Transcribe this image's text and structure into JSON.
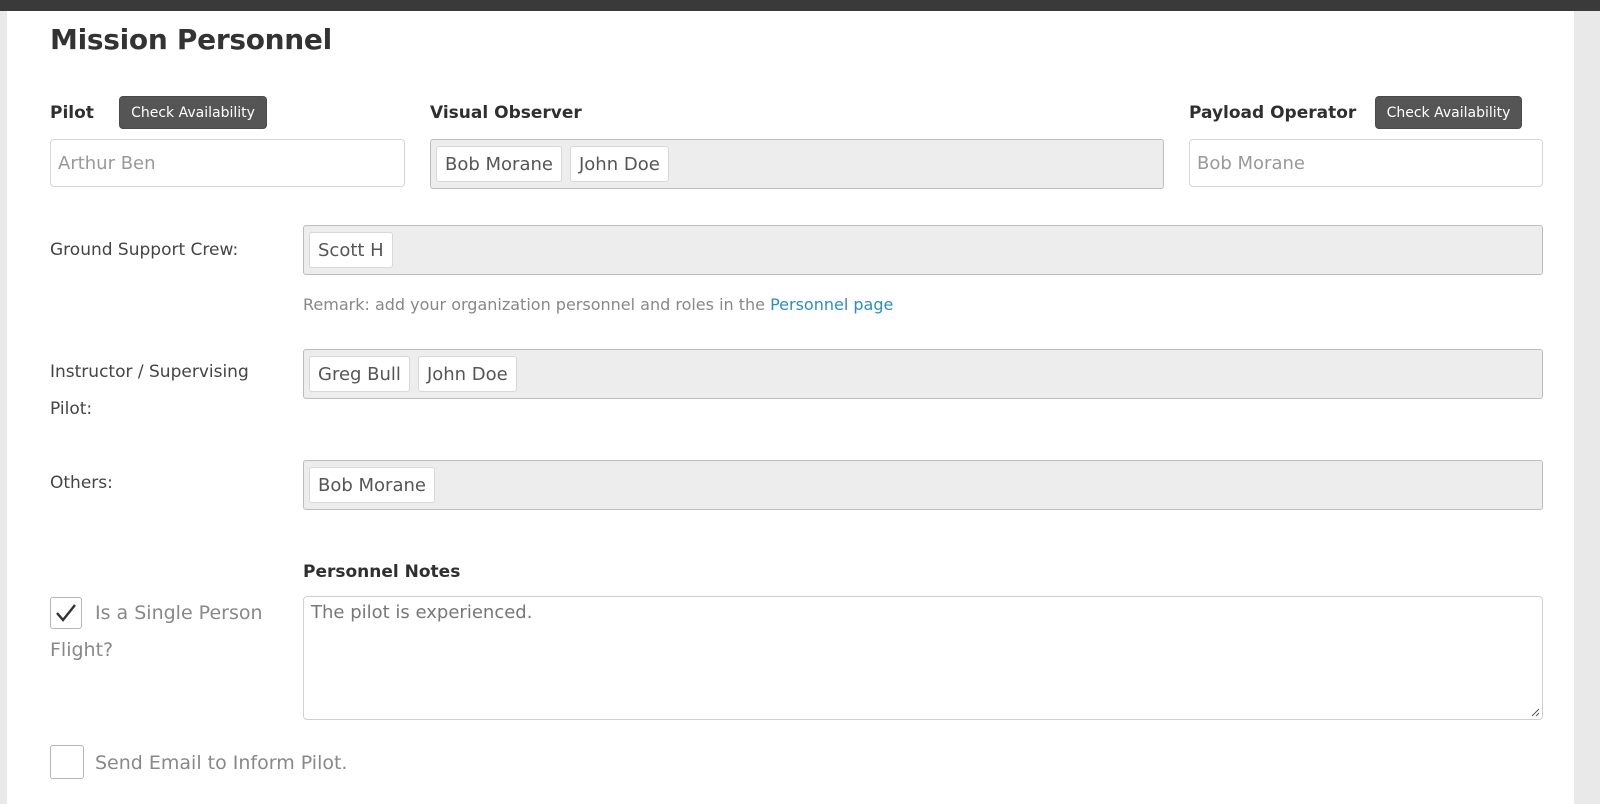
{
  "section_title": "Mission Personnel",
  "pilot": {
    "label": "Pilot",
    "check_button": "Check Availability",
    "value": "Arthur Ben"
  },
  "visual_observer": {
    "label": "Visual Observer",
    "tags": [
      "Bob Morane",
      "John Doe"
    ]
  },
  "payload_operator": {
    "label": "Payload Operator",
    "check_button": "Check Availability",
    "value": "Bob Morane"
  },
  "ground_support": {
    "label": "Ground Support Crew:",
    "tags": [
      "Scott H"
    ]
  },
  "remark": {
    "text": "Remark: add your organization personnel and roles in the ",
    "link": "Personnel page"
  },
  "instructor": {
    "label_line1": "Instructor / Supervising",
    "label_line2": "Pilot:",
    "tags": [
      "Greg Bull",
      "John Doe"
    ]
  },
  "others": {
    "label": "Others:",
    "tags": [
      "Bob Morane"
    ]
  },
  "notes": {
    "label": "Personnel Notes",
    "value": "The pilot is experienced."
  },
  "single_person": {
    "label_line1": "Is a Single Person",
    "label_line2": "Flight?",
    "checked": true
  },
  "send_email": {
    "label": "Send Email to Inform Pilot.",
    "checked": false
  },
  "icons": {
    "check": "checkmark-icon",
    "resize": "resize-handle-icon"
  },
  "colors": {
    "button_bg": "#555555",
    "link": "#2a8ec0",
    "tag_box_bg": "#ededed",
    "topbar": "#3a3a3a"
  }
}
